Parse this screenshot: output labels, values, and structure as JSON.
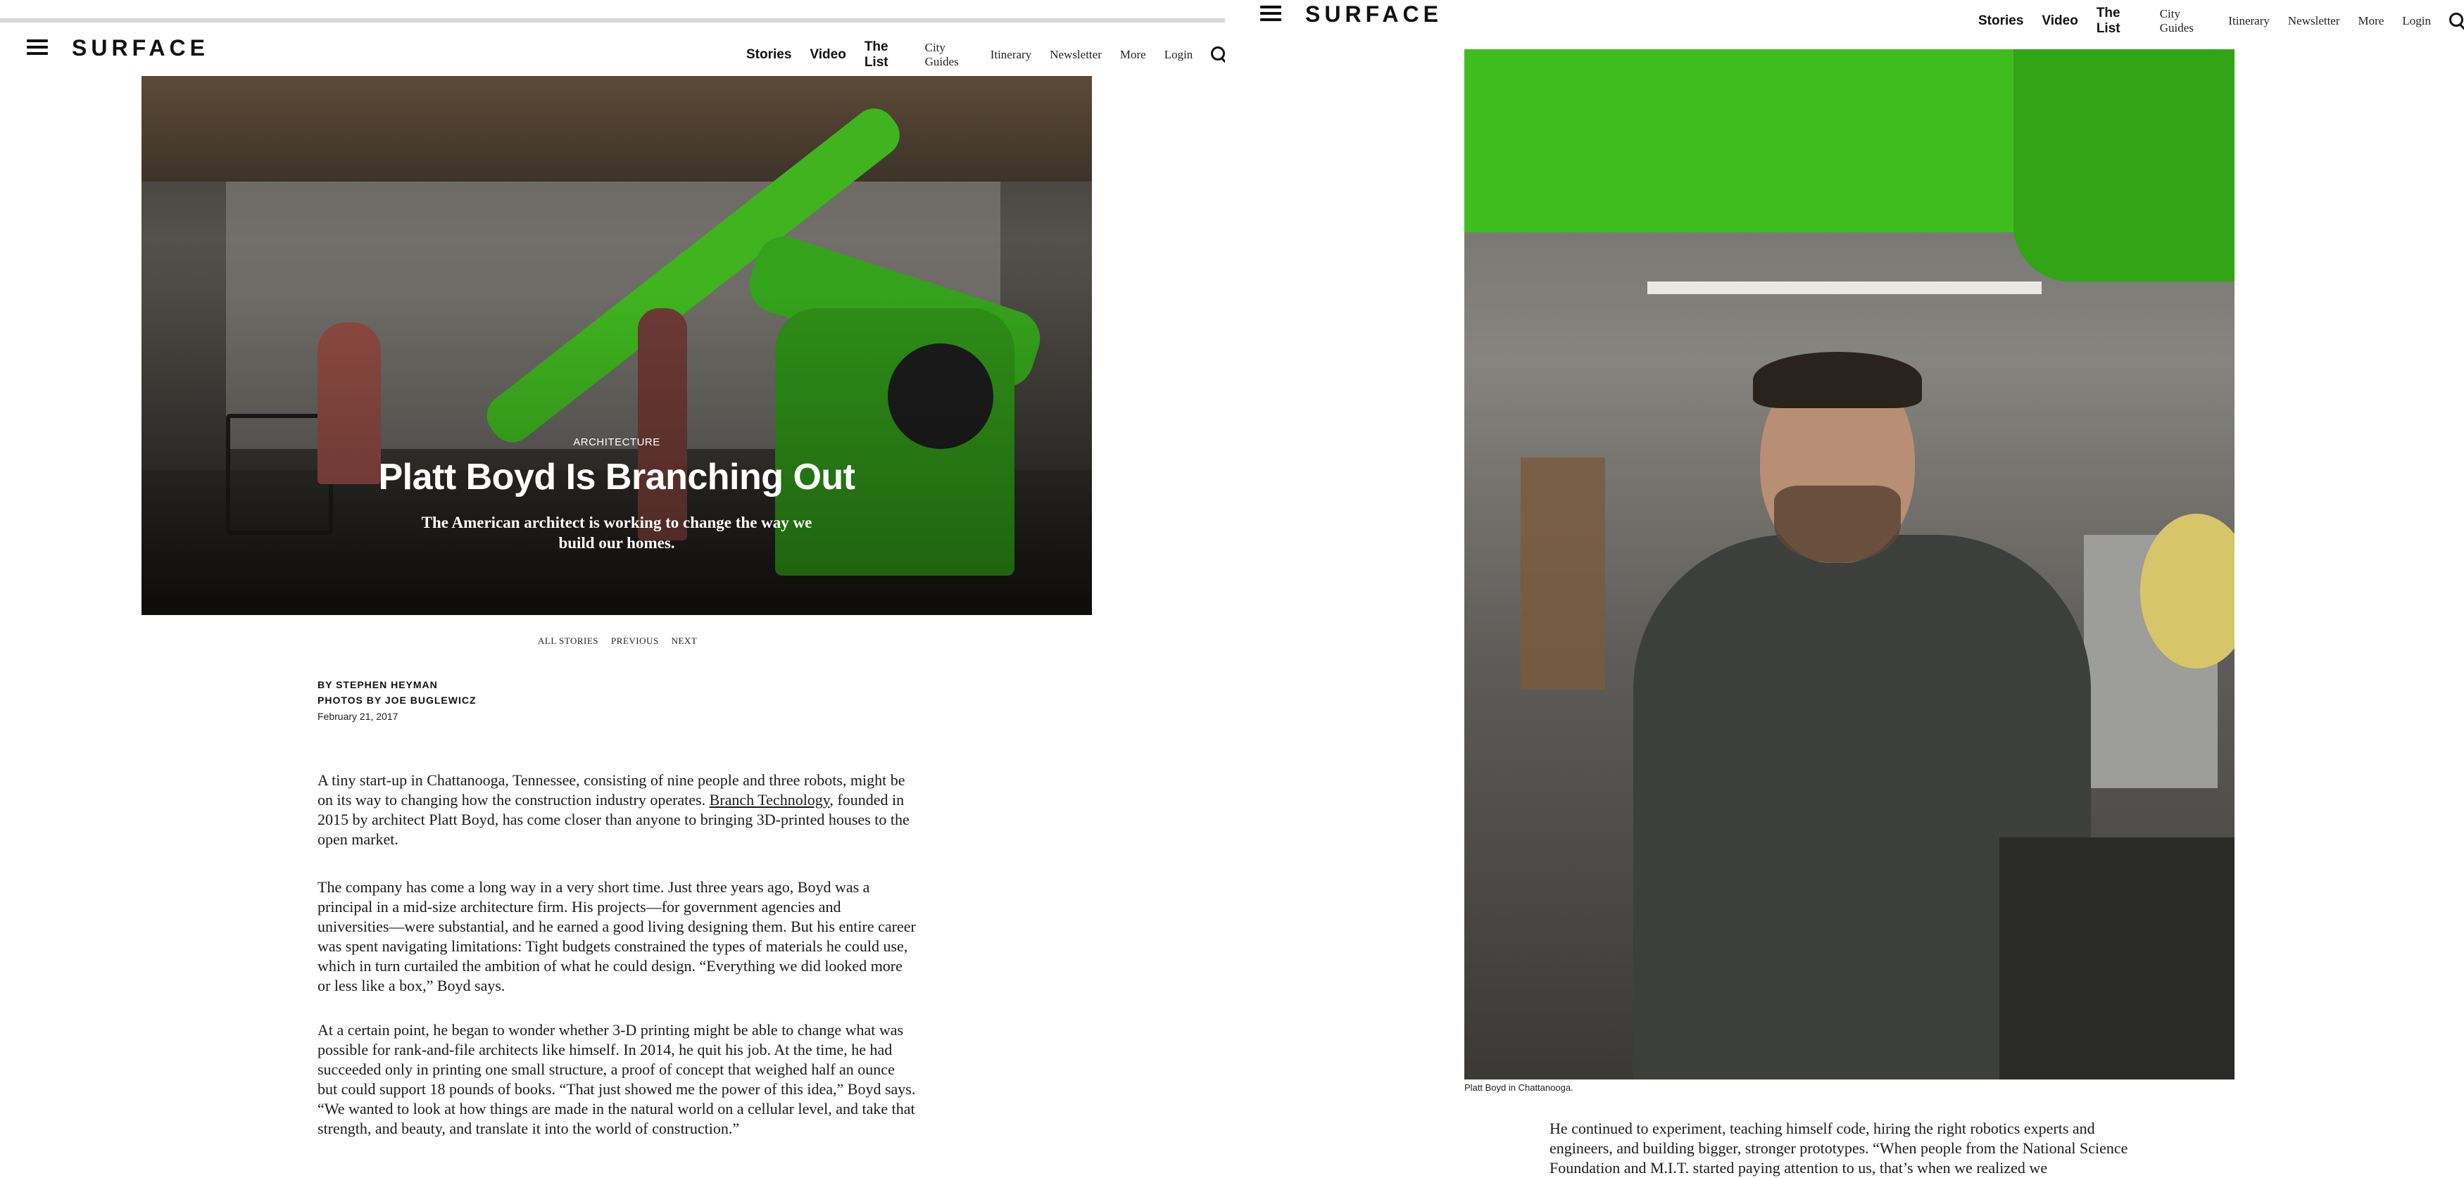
{
  "left": {
    "nav": {
      "logo": "SURFACE",
      "items": [
        {
          "label": "Stories",
          "style": "bold"
        },
        {
          "label": "Video",
          "style": "bold"
        },
        {
          "label": "The List",
          "style": "bold"
        },
        {
          "label": "City Guides",
          "style": "reg"
        },
        {
          "label": "Itinerary",
          "style": "reg"
        },
        {
          "label": "Newsletter",
          "style": "reg"
        },
        {
          "label": "More",
          "style": "reg"
        },
        {
          "label": "Login",
          "style": "reg"
        }
      ]
    },
    "hero": {
      "kicker": "ARCHITECTURE",
      "title": "Platt Boyd Is Branching Out",
      "dek": "The American architect is working to change the way we build our homes."
    },
    "story_nav": [
      "ALL STORIES",
      "PREVIOUS",
      "NEXT"
    ],
    "byline": [
      "BY STEPHEN HEYMAN",
      "PHOTOS BY JOE BUGLEWICZ"
    ],
    "date": "February 21, 2017",
    "paragraphs": {
      "p1_a": "A tiny start-up in Chattanooga, Tennessee, consisting of nine people and three robots, might be on its way to changing how the construction industry operates.",
      "p1_link": "Branch Technology",
      "p1_b": ", founded in 2015 by architect Platt Boyd, has come closer than anyone to bringing 3D-printed houses to the open market.",
      "p2": "The company has come a long way in a very short time. Just three years ago, Boyd was a principal in a mid-size architecture firm. His projects—for government agencies and universities—were substantial, and he earned a good living designing them. But his entire career was spent navigating limitations: Tight budgets constrained the types of materials he could use, which in turn curtailed the ambition of what he could design. “Everything we did looked more or less like a box,” Boyd says.",
      "p3": "At a certain point, he began to wonder whether 3-D printing might be able to change what was possible for rank-and-file architects like himself. In 2014, he quit his job. At the time, he had succeeded only in printing one small structure, a proof of concept that weighed half an ounce but could support 18 pounds of books. “That just showed me the power of this idea,” Boyd says. “We wanted to look at how things are made in the natural world on a cellular level, and take that strength, and beauty, and translate it into the world of construction.”"
    }
  },
  "right": {
    "nav": {
      "logo": "SURFACE",
      "items": [
        {
          "label": "Stories",
          "style": "bold"
        },
        {
          "label": "Video",
          "style": "bold"
        },
        {
          "label": "The List",
          "style": "bold"
        },
        {
          "label": "City Guides",
          "style": "reg"
        },
        {
          "label": "Itinerary",
          "style": "reg"
        },
        {
          "label": "Newsletter",
          "style": "reg"
        },
        {
          "label": "More",
          "style": "reg"
        },
        {
          "label": "Login",
          "style": "reg"
        }
      ]
    },
    "photo_caption": "Platt Boyd in Chattanooga.",
    "paragraph": "He continued to experiment, teaching himself code, hiring the right robotics experts and engineers, and building bigger, stronger prototypes. “When people from the National Science Foundation and M.I.T. started paying attention to us, that’s when we realized we"
  },
  "icons": {
    "menu": "hamburger-icon",
    "search": "search-icon",
    "scroll": "chevron-down-icon"
  }
}
